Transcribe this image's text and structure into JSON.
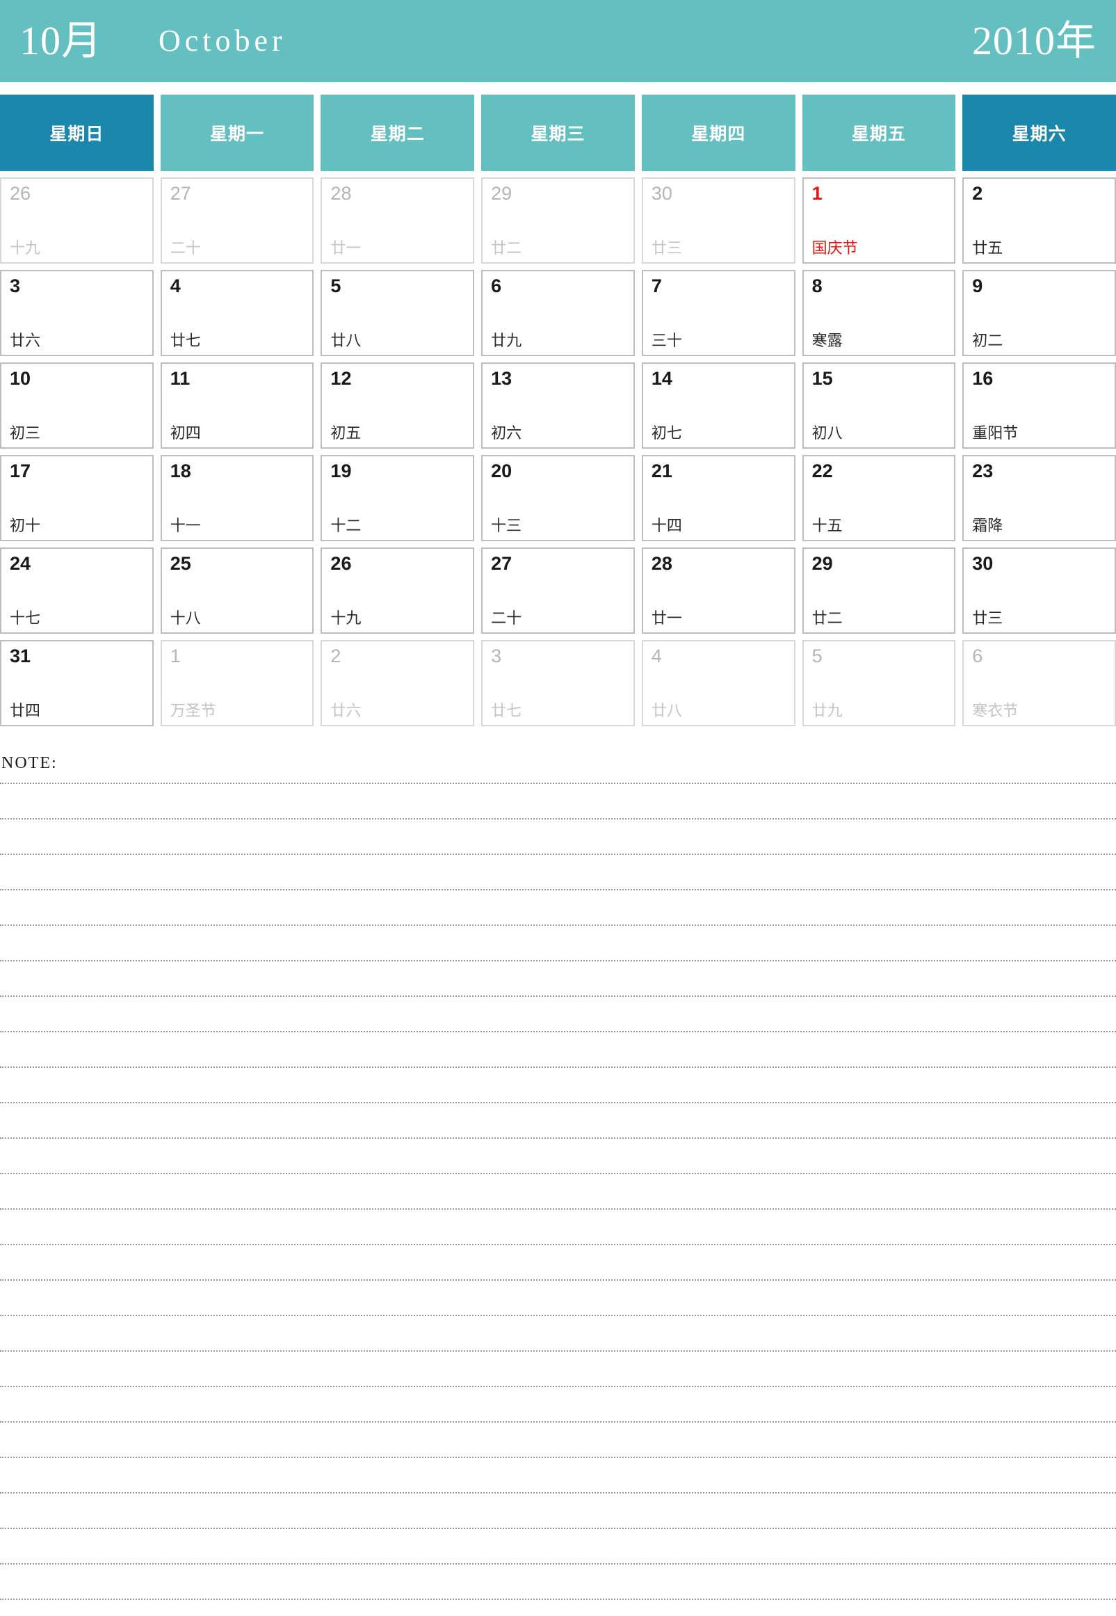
{
  "header": {
    "month_cn": "10月",
    "month_en": "October",
    "year_cn": "2010年",
    "banner_color": "#64c0c0",
    "weekend_color": "#1b87ad"
  },
  "weekdays": [
    {
      "label": "星期日",
      "weekend": true
    },
    {
      "label": "星期一",
      "weekend": false
    },
    {
      "label": "星期二",
      "weekend": false
    },
    {
      "label": "星期三",
      "weekend": false
    },
    {
      "label": "星期四",
      "weekend": false
    },
    {
      "label": "星期五",
      "weekend": false
    },
    {
      "label": "星期六",
      "weekend": true
    }
  ],
  "weeks": [
    [
      {
        "day": "26",
        "lunar": "十九",
        "muted": true,
        "holiday": false
      },
      {
        "day": "27",
        "lunar": "二十",
        "muted": true,
        "holiday": false
      },
      {
        "day": "28",
        "lunar": "廿一",
        "muted": true,
        "holiday": false
      },
      {
        "day": "29",
        "lunar": "廿二",
        "muted": true,
        "holiday": false
      },
      {
        "day": "30",
        "lunar": "廿三",
        "muted": true,
        "holiday": false
      },
      {
        "day": "1",
        "lunar": "国庆节",
        "muted": false,
        "holiday": true
      },
      {
        "day": "2",
        "lunar": "廿五",
        "muted": false,
        "holiday": false
      }
    ],
    [
      {
        "day": "3",
        "lunar": "廿六",
        "muted": false,
        "holiday": false
      },
      {
        "day": "4",
        "lunar": "廿七",
        "muted": false,
        "holiday": false
      },
      {
        "day": "5",
        "lunar": "廿八",
        "muted": false,
        "holiday": false
      },
      {
        "day": "6",
        "lunar": "廿九",
        "muted": false,
        "holiday": false
      },
      {
        "day": "7",
        "lunar": "三十",
        "muted": false,
        "holiday": false
      },
      {
        "day": "8",
        "lunar": "寒露",
        "muted": false,
        "holiday": false
      },
      {
        "day": "9",
        "lunar": "初二",
        "muted": false,
        "holiday": false
      }
    ],
    [
      {
        "day": "10",
        "lunar": "初三",
        "muted": false,
        "holiday": false
      },
      {
        "day": "11",
        "lunar": "初四",
        "muted": false,
        "holiday": false
      },
      {
        "day": "12",
        "lunar": "初五",
        "muted": false,
        "holiday": false
      },
      {
        "day": "13",
        "lunar": "初六",
        "muted": false,
        "holiday": false
      },
      {
        "day": "14",
        "lunar": "初七",
        "muted": false,
        "holiday": false
      },
      {
        "day": "15",
        "lunar": "初八",
        "muted": false,
        "holiday": false
      },
      {
        "day": "16",
        "lunar": "重阳节",
        "muted": false,
        "holiday": false
      }
    ],
    [
      {
        "day": "17",
        "lunar": "初十",
        "muted": false,
        "holiday": false
      },
      {
        "day": "18",
        "lunar": "十一",
        "muted": false,
        "holiday": false
      },
      {
        "day": "19",
        "lunar": "十二",
        "muted": false,
        "holiday": false
      },
      {
        "day": "20",
        "lunar": "十三",
        "muted": false,
        "holiday": false
      },
      {
        "day": "21",
        "lunar": "十四",
        "muted": false,
        "holiday": false
      },
      {
        "day": "22",
        "lunar": "十五",
        "muted": false,
        "holiday": false
      },
      {
        "day": "23",
        "lunar": "霜降",
        "muted": false,
        "holiday": false
      }
    ],
    [
      {
        "day": "24",
        "lunar": "十七",
        "muted": false,
        "holiday": false
      },
      {
        "day": "25",
        "lunar": "十八",
        "muted": false,
        "holiday": false
      },
      {
        "day": "26",
        "lunar": "十九",
        "muted": false,
        "holiday": false
      },
      {
        "day": "27",
        "lunar": "二十",
        "muted": false,
        "holiday": false
      },
      {
        "day": "28",
        "lunar": "廿一",
        "muted": false,
        "holiday": false
      },
      {
        "day": "29",
        "lunar": "廿二",
        "muted": false,
        "holiday": false
      },
      {
        "day": "30",
        "lunar": "廿三",
        "muted": false,
        "holiday": false
      }
    ],
    [
      {
        "day": "31",
        "lunar": "廿四",
        "muted": false,
        "holiday": false
      },
      {
        "day": "1",
        "lunar": "万圣节",
        "muted": true,
        "holiday": false
      },
      {
        "day": "2",
        "lunar": "廿六",
        "muted": true,
        "holiday": false
      },
      {
        "day": "3",
        "lunar": "廿七",
        "muted": true,
        "holiday": false
      },
      {
        "day": "4",
        "lunar": "廿八",
        "muted": true,
        "holiday": false
      },
      {
        "day": "5",
        "lunar": "廿九",
        "muted": true,
        "holiday": false
      },
      {
        "day": "6",
        "lunar": "寒衣节",
        "muted": true,
        "holiday": false
      }
    ]
  ],
  "note": {
    "label": "NOTE:",
    "line_count": 24
  }
}
